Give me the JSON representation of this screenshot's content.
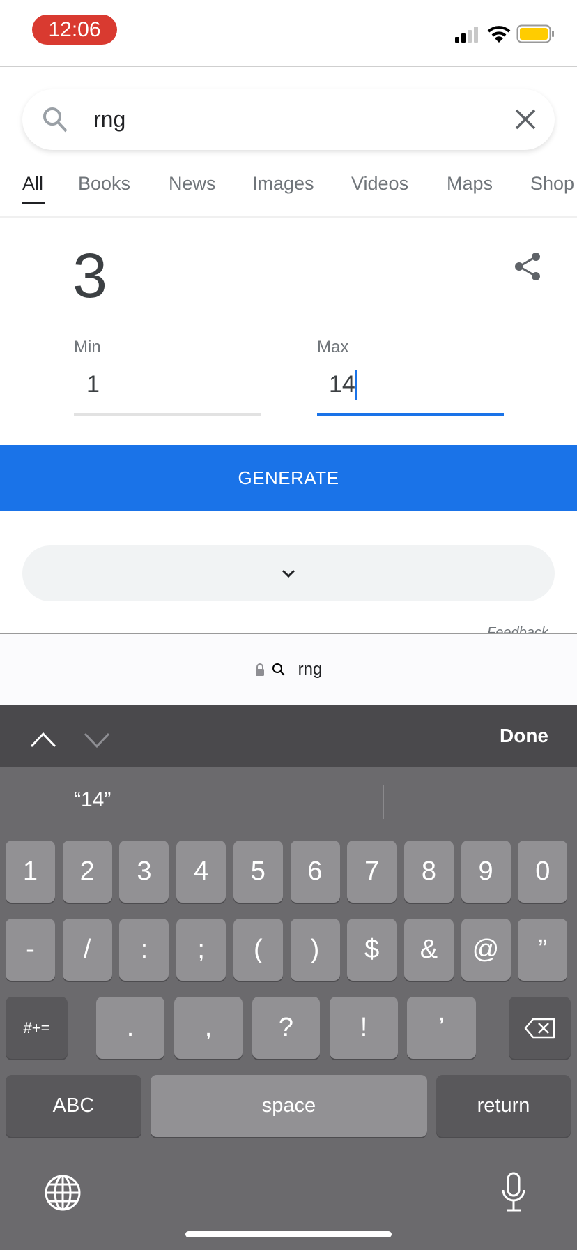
{
  "status_bar": {
    "time": "12:06",
    "battery_color": "#ffcc00",
    "icons": [
      "signal-icon",
      "wifi-icon",
      "battery-icon"
    ]
  },
  "search": {
    "query": "rng",
    "icons": [
      "search-icon",
      "close-icon"
    ]
  },
  "tabs": [
    {
      "label": "All",
      "active": true
    },
    {
      "label": "Books"
    },
    {
      "label": "News"
    },
    {
      "label": "Images"
    },
    {
      "label": "Videos"
    },
    {
      "label": "Maps"
    },
    {
      "label": "Shop"
    }
  ],
  "rng": {
    "result": "3",
    "min_label": "Min",
    "min_value": "1",
    "max_label": "Max",
    "max_value": "14",
    "generate_label": "GENERATE",
    "accent": "#1a73e8",
    "feedback": "Feedback"
  },
  "address_bar": {
    "text": "rng"
  },
  "keyboard_toolbar": {
    "done_label": "Done"
  },
  "keyboard": {
    "suggestions": [
      "“14”",
      "",
      ""
    ],
    "row1": [
      "1",
      "2",
      "3",
      "4",
      "5",
      "6",
      "7",
      "8",
      "9",
      "0"
    ],
    "row2": [
      "-",
      "/",
      ":",
      ";",
      "(",
      ")",
      "$",
      "&",
      "@",
      "”"
    ],
    "row3": [
      "#+=",
      ".",
      ",",
      "?",
      "!",
      "’"
    ],
    "row4": [
      "ABC",
      "space",
      "return"
    ]
  }
}
